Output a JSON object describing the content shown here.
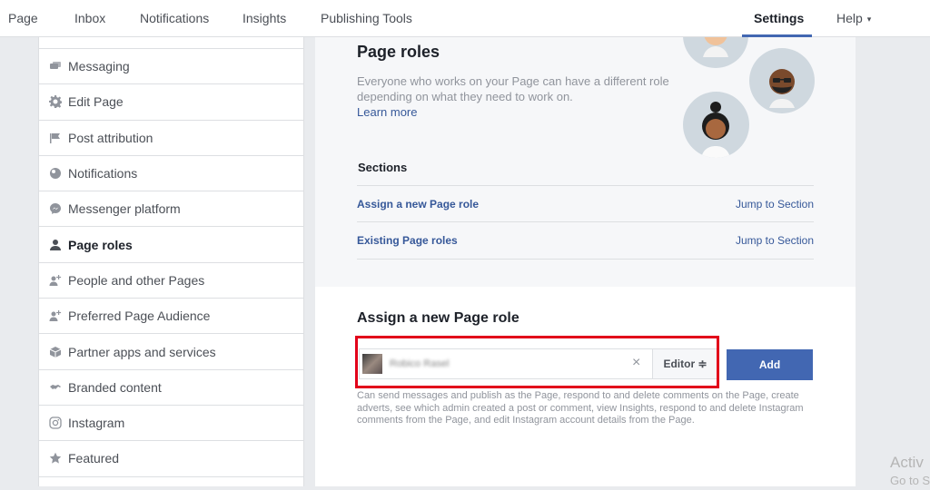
{
  "topnav": {
    "items": [
      "Page",
      "Inbox",
      "Notifications",
      "Insights",
      "Publishing Tools"
    ],
    "settings": "Settings",
    "help": "Help",
    "help_caret": "▾"
  },
  "sidebar": {
    "items": [
      {
        "label": "Messaging",
        "icon": "messaging-icon"
      },
      {
        "label": "Edit Page",
        "icon": "gear-icon"
      },
      {
        "label": "Post attribution",
        "icon": "flag-icon"
      },
      {
        "label": "Notifications",
        "icon": "globe-icon"
      },
      {
        "label": "Messenger platform",
        "icon": "messenger-icon"
      },
      {
        "label": "Page roles",
        "icon": "person-icon",
        "active": true
      },
      {
        "label": "People and other Pages",
        "icon": "people-add-icon"
      },
      {
        "label": "Preferred Page Audience",
        "icon": "people-add-icon"
      },
      {
        "label": "Partner apps and services",
        "icon": "cube-icon"
      },
      {
        "label": "Branded content",
        "icon": "handshake-icon"
      },
      {
        "label": "Instagram",
        "icon": "instagram-icon"
      },
      {
        "label": "Featured",
        "icon": "star-icon"
      }
    ]
  },
  "main": {
    "title": "Page roles",
    "description": "Everyone who works on your Page can have a different role depending on what they need to work on.",
    "learn_more": "Learn more",
    "sections_label": "Sections",
    "sections": [
      {
        "label": "Assign a new Page role",
        "jump": "Jump to Section"
      },
      {
        "label": "Existing Page roles",
        "jump": "Jump to Section"
      }
    ],
    "assign_title": "Assign a new Page role",
    "assign": {
      "person_name": "Robico Rasel",
      "clear": "×",
      "role": "Editor ≑",
      "add": "Add",
      "help": "Can send messages and publish as the Page, respond to and delete comments on the Page, create adverts, see which admin created a post or comment, view Insights, respond to and delete Instagram comments from the Page, and edit Instagram account details from the Page."
    }
  },
  "watermark": {
    "line1": "Activ",
    "line2": "Go to S"
  },
  "colors": {
    "accent": "#4267b2",
    "link": "#365899",
    "highlight": "#e2001a"
  }
}
